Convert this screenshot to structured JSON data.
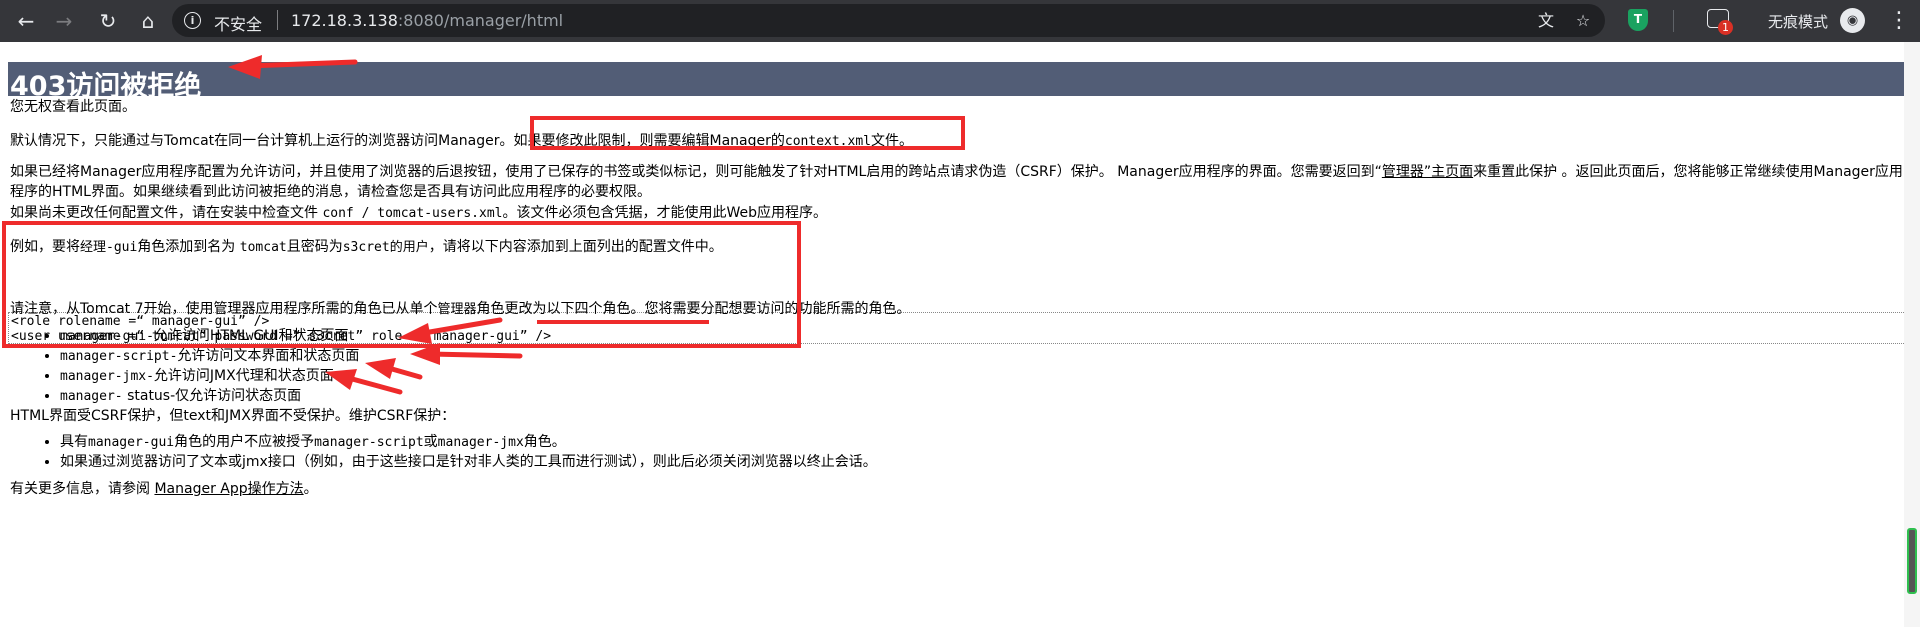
{
  "browser": {
    "security_label": "不安全",
    "url_host": "172.18.3.138",
    "url_path": ":8080/manager/html",
    "download_badge": "1",
    "incognito_label": "无痕模式",
    "icons": [
      "back-icon",
      "forward-icon",
      "reload-icon",
      "home-icon",
      "info-icon",
      "translate-icon",
      "star-icon",
      "extension-icon",
      "download-icon",
      "incognito-icon",
      "menu-icon"
    ]
  },
  "page": {
    "heading": "403访问被拒绝",
    "p1": "您无权查看此页面。",
    "p2_a": "默认情况下，只能通过与Tomcat在同一台计算机上运行的浏览器访问Manager。",
    "p2_b": "如果要修改此限制，则需要编辑Manager的",
    "p2_code": "context.xml",
    "p2_c": "文件。",
    "p3_a": "如果已经将Manager应用程序配置为允许访问，并且使用了浏览器的后退按钮，使用了已保存的书签或类似标记，则可能触发了针对HTML启用的跨站点请求伪造（CSRF）保护。 Manager应用程序的界面。您需要返回到“",
    "p3_link": "管理器”主页面",
    "p3_b": "来重置此保护 。返回此页面后，您将能够正常继续使用Manager应用程序的HTML界面。如果继续看到此访问被拒绝的消息，请检查您是否具有访问此应用程序的必要权限。",
    "p4_a": "如果尚未更改任何配置文件，请在安装中检查文件",
    "p4_code": "conf / tomcat-users.xml",
    "p4_b": "。该文件必须包含凭据，才能使用此Web应用程序。",
    "p5_a": "例如，要将",
    "p5_code1": "经理-gui",
    "p5_b": "角色添加到名为",
    "p5_code2": "tomcat",
    "p5_c": "且密码为",
    "p5_code3": "s3cret的用户",
    "p5_d": "，请将以下内容添加到上面列出的配置文件中。",
    "pre_line1": "<role rolename =“ manager-gui” />",
    "pre_line2": "<user username =“ tomcat” password =“ s3cret” role =“ manager-gui” />",
    "p6_a": "请注意，从Tomcat 7开始，使用管理器应用程序所需的角色已从单个",
    "p6_code": "管理器",
    "p6_b": "角色更改为以下四个角色。您将需要分配想要访问的功能所需的角色。",
    "roles": [
      {
        "code": "manager-gui-",
        "text": "允许访问HTML GUI和状态页面"
      },
      {
        "code": "manager-script-",
        "text": "允许访问文本界面和状态页面"
      },
      {
        "code": "manager-jmx-",
        "text": "允许访问JMX代理和状态页面"
      },
      {
        "code": "manager-",
        "text": " status-仅允许访问状态页面"
      }
    ],
    "p7": "HTML界面受CSRF保护，但text和JMX界面不受保护。维护CSRF保护：",
    "csrf1_a": "具有",
    "csrf1_code1": "manager-gui",
    "csrf1_b": "角色的用户不应被授予",
    "csrf1_code2": "manager-script",
    "csrf1_c": "或",
    "csrf1_code3": "manager-jmx",
    "csrf1_d": "角色。",
    "csrf2": "如果通过浏览器访问了文本或jmx接口（例如，由于这些接口是针对非人类的工具而进行测试），则此后必须关闭浏览器以终止会话。",
    "p8_a": "有关更多信息，请参阅",
    "p8_link": "Manager App操作方法",
    "p8_b": "。"
  },
  "colors": {
    "chrome": "#35363a",
    "omnibox": "#202124",
    "banner": "#525d76",
    "annotation": "#ee2b2b"
  }
}
